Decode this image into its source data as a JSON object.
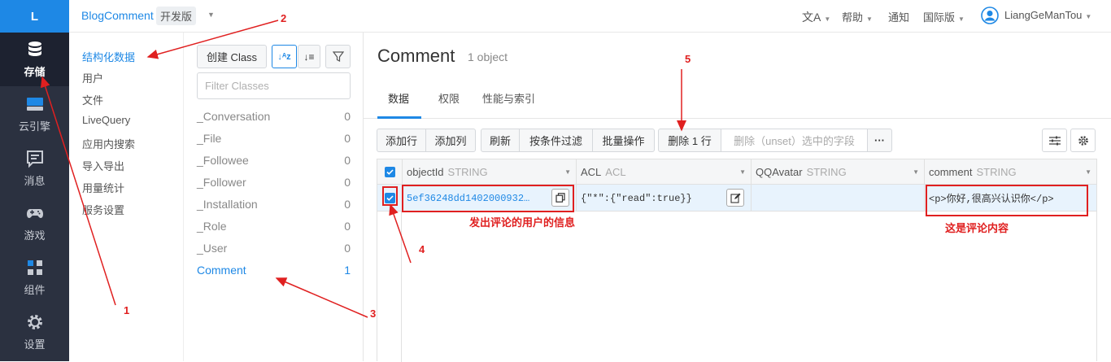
{
  "nav": {
    "logo": "L",
    "items": [
      {
        "label": "存储",
        "icon": "database-icon",
        "active": true
      },
      {
        "label": "云引擎",
        "icon": "cloud-engine-icon"
      },
      {
        "label": "消息",
        "icon": "message-icon"
      },
      {
        "label": "游戏",
        "icon": "gamepad-icon"
      },
      {
        "label": "组件",
        "icon": "components-icon"
      },
      {
        "label": "设置",
        "icon": "gear-icon"
      }
    ]
  },
  "header": {
    "app_name": "BlogComment",
    "env_badge": "开发版",
    "lang_icon": "translate-icon",
    "help": "帮助",
    "notify": "通知",
    "region": "国际版",
    "user": "LiangGeManTou"
  },
  "storage_menu": [
    "结构化数据",
    "用户",
    "文件",
    "LiveQuery",
    "应用内搜索",
    "导入导出",
    "用量统计",
    "服务设置"
  ],
  "classes": {
    "create_label": "创建 Class",
    "filter_placeholder": "Filter Classes",
    "list": [
      {
        "name": "_Conversation",
        "count": "0"
      },
      {
        "name": "_File",
        "count": "0"
      },
      {
        "name": "_Followee",
        "count": "0"
      },
      {
        "name": "_Follower",
        "count": "0"
      },
      {
        "name": "_Installation",
        "count": "0"
      },
      {
        "name": "_Role",
        "count": "0"
      },
      {
        "name": "_User",
        "count": "0"
      },
      {
        "name": "Comment",
        "count": "1"
      }
    ]
  },
  "main": {
    "title": "Comment",
    "count": "1 object",
    "tabs": [
      "数据",
      "权限",
      "性能与索引"
    ],
    "toolbar": {
      "add_row": "添加行",
      "add_col": "添加列",
      "refresh": "刷新",
      "filter": "按条件过滤",
      "batch": "批量操作",
      "delete": "删除 1 行",
      "unset": "删除（unset）选中的字段",
      "more": "···"
    },
    "columns": [
      {
        "name": "objectId",
        "type": "STRING"
      },
      {
        "name": "ACL",
        "type": "ACL"
      },
      {
        "name": "QQAvatar",
        "type": "STRING"
      },
      {
        "name": "comment",
        "type": "STRING"
      }
    ],
    "row": {
      "objectId": "5ef36248dd1402000932…",
      "acl": "{\"*\":{\"read\":true}}",
      "qqavatar": "",
      "comment": "<p>你好,很高兴认识你</p>"
    }
  },
  "annotations": {
    "n1": "1",
    "n2": "2",
    "n3": "3",
    "n4": "4",
    "n5": "5",
    "user_info": "发出评论的用户的信息",
    "comment_content": "这是评论内容"
  },
  "colors": {
    "accent": "#1e88e5",
    "sidebar": "#2b3140",
    "annotation": "#e02020"
  }
}
